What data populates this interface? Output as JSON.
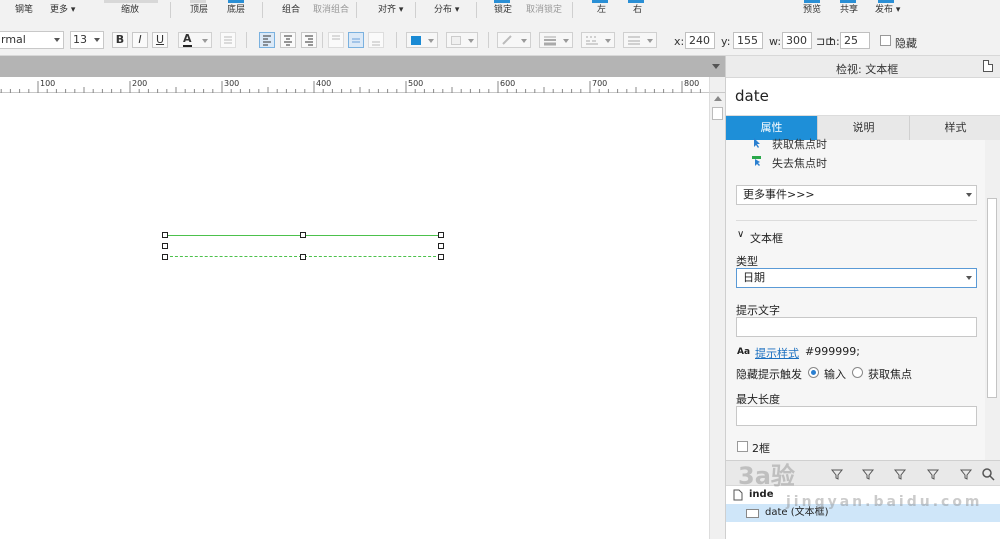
{
  "toolbar_top": {
    "labels": {
      "pen": "钢笔",
      "more": "更多",
      "zoom": "缩放",
      "top": "顶层",
      "bottom": "底层",
      "group": "组合",
      "ungroup": "取消组合",
      "align": "对齐",
      "distribute": "分布",
      "lock": "锁定",
      "unlock": "取消锁定",
      "left": "左",
      "right": "右",
      "preview": "预览",
      "share": "共享",
      "publish": "发布"
    }
  },
  "toolbar_format": {
    "style_value": "rmal",
    "font_size": "13",
    "bold": "B",
    "italic": "I",
    "underline": "U",
    "font_color_glyph": "A",
    "fill_color": "#1a8ad4",
    "x_label": "x:",
    "x_value": "240",
    "y_label": "y:",
    "y_value": "155",
    "w_label": "w:",
    "w_value": "300",
    "h_label": "h:",
    "h_value": "25",
    "hide_label": "隐藏"
  },
  "ruler": {
    "ticks": [
      "100",
      "200",
      "300",
      "400",
      "500",
      "600",
      "700",
      "800"
    ]
  },
  "panel": {
    "header_title": "检视: 文本框",
    "widget_name": "date",
    "tabs": [
      {
        "label": "属性",
        "active": true
      },
      {
        "label": "说明",
        "active": false
      },
      {
        "label": "样式",
        "active": false
      }
    ],
    "events": [
      "获取焦点时",
      "失去焦点时"
    ],
    "more_events": "更多事件>>>",
    "section_title": "文本框",
    "type_label": "类型",
    "type_value": "日期",
    "hint_label": "提示文字",
    "hint_style_icon": "Aa",
    "hint_style_link": "提示样式",
    "hint_color": "#999999;",
    "hide_hint_label": "隐藏提示触发",
    "hide_hint_opt1": "输入",
    "hide_hint_opt2": "获取焦点",
    "maxlen_label": "最大长度",
    "partial_label": "2框"
  },
  "outline": {
    "rows": [
      {
        "label": "inde",
        "selected": false
      },
      {
        "label": "date (文本框)",
        "selected": true
      }
    ]
  },
  "watermark": {
    "logo": "3a验",
    "url": "jingyan.baidu.com"
  }
}
